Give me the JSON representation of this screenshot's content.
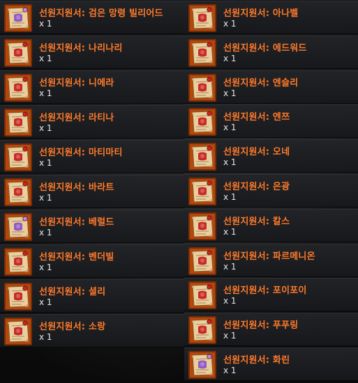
{
  "left_items": [
    {
      "name": "선원지원서: 검은 망령 빌리어드",
      "qty": "x 1",
      "seal": "purple"
    },
    {
      "name": "선원지원서: 나리나리",
      "qty": "x 1",
      "seal": "red"
    },
    {
      "name": "선원지원서: 니에라",
      "qty": "x 1",
      "seal": "red"
    },
    {
      "name": "선원지원서: 라티나",
      "qty": "x 1",
      "seal": "red"
    },
    {
      "name": "선원지원서: 마티마티",
      "qty": "x 1",
      "seal": "red"
    },
    {
      "name": "선원지원서: 바라트",
      "qty": "x 1",
      "seal": "red"
    },
    {
      "name": "선원지원서: 베럴드",
      "qty": "x 1",
      "seal": "purple"
    },
    {
      "name": "선원지원서: 벤더빌",
      "qty": "x 1",
      "seal": "red"
    },
    {
      "name": "선원지원서: 셜리",
      "qty": "x 1",
      "seal": "red"
    },
    {
      "name": "선원지원서: 소랑",
      "qty": "x 1",
      "seal": "red"
    }
  ],
  "right_items": [
    {
      "name": "선원지원서: 아나벨",
      "qty": "x 1",
      "seal": "red"
    },
    {
      "name": "선원지원서: 에드워드",
      "qty": "x 1",
      "seal": "red"
    },
    {
      "name": "선원지원서: 엔슬리",
      "qty": "x 1",
      "seal": "red"
    },
    {
      "name": "선원지원서: 엔쯔",
      "qty": "x 1",
      "seal": "red"
    },
    {
      "name": "선원지원서: 오네",
      "qty": "x 1",
      "seal": "red"
    },
    {
      "name": "선원지원서: 은광",
      "qty": "x 1",
      "seal": "red"
    },
    {
      "name": "선원지원서: 칼스",
      "qty": "x 1",
      "seal": "red"
    },
    {
      "name": "선원지원서: 파르메니온",
      "qty": "x 1",
      "seal": "red"
    },
    {
      "name": "선원지원서: 포이포이",
      "qty": "x 1",
      "seal": "red"
    },
    {
      "name": "선원지원서: 푸푸링",
      "qty": "x 1",
      "seal": "red"
    },
    {
      "name": "선원지원서: 화린",
      "qty": "x 1",
      "seal": "purple"
    }
  ],
  "colors": {
    "item_name": "#ff7a2a",
    "quantity": "#e8e8e8",
    "seal_red": "#c41818",
    "seal_purple": "#8a4fc4"
  },
  "icon": "sailor-application-scroll-icon"
}
